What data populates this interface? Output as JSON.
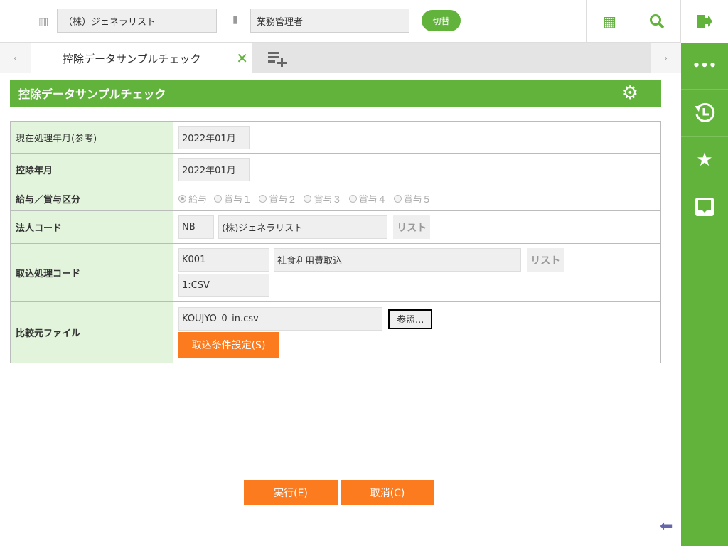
{
  "header": {
    "company": "（株）ジェネラリスト",
    "role": "業務管理者",
    "switch_label": "切替"
  },
  "tabs": {
    "active": "控除データサンプルチェック"
  },
  "page": {
    "title": "控除データサンプルチェック"
  },
  "form": {
    "rows": [
      {
        "label": "現在処理年月(参考)",
        "value": "2022年01月"
      },
      {
        "label": "控除年月",
        "value": "2022年01月"
      },
      {
        "label": "給与／賞与区分",
        "options": [
          "給与",
          "賞与１",
          "賞与２",
          "賞与３",
          "賞与４",
          "賞与５"
        ],
        "selected": "給与"
      },
      {
        "label": "法人コード",
        "code": "NB",
        "name": "(株)ジェネラリスト",
        "list_label": "リスト"
      },
      {
        "label": "取込処理コード",
        "code": "K001",
        "name": "社食利用費取込",
        "list_label": "リスト",
        "format": "1:CSV"
      },
      {
        "label": "比較元ファイル",
        "file": "KOUJYO_0_in.csv",
        "browse_label": "参照...",
        "settings_label": "取込条件設定(S)"
      }
    ]
  },
  "actions": {
    "execute": "実行(E)",
    "cancel": "取消(C)"
  }
}
